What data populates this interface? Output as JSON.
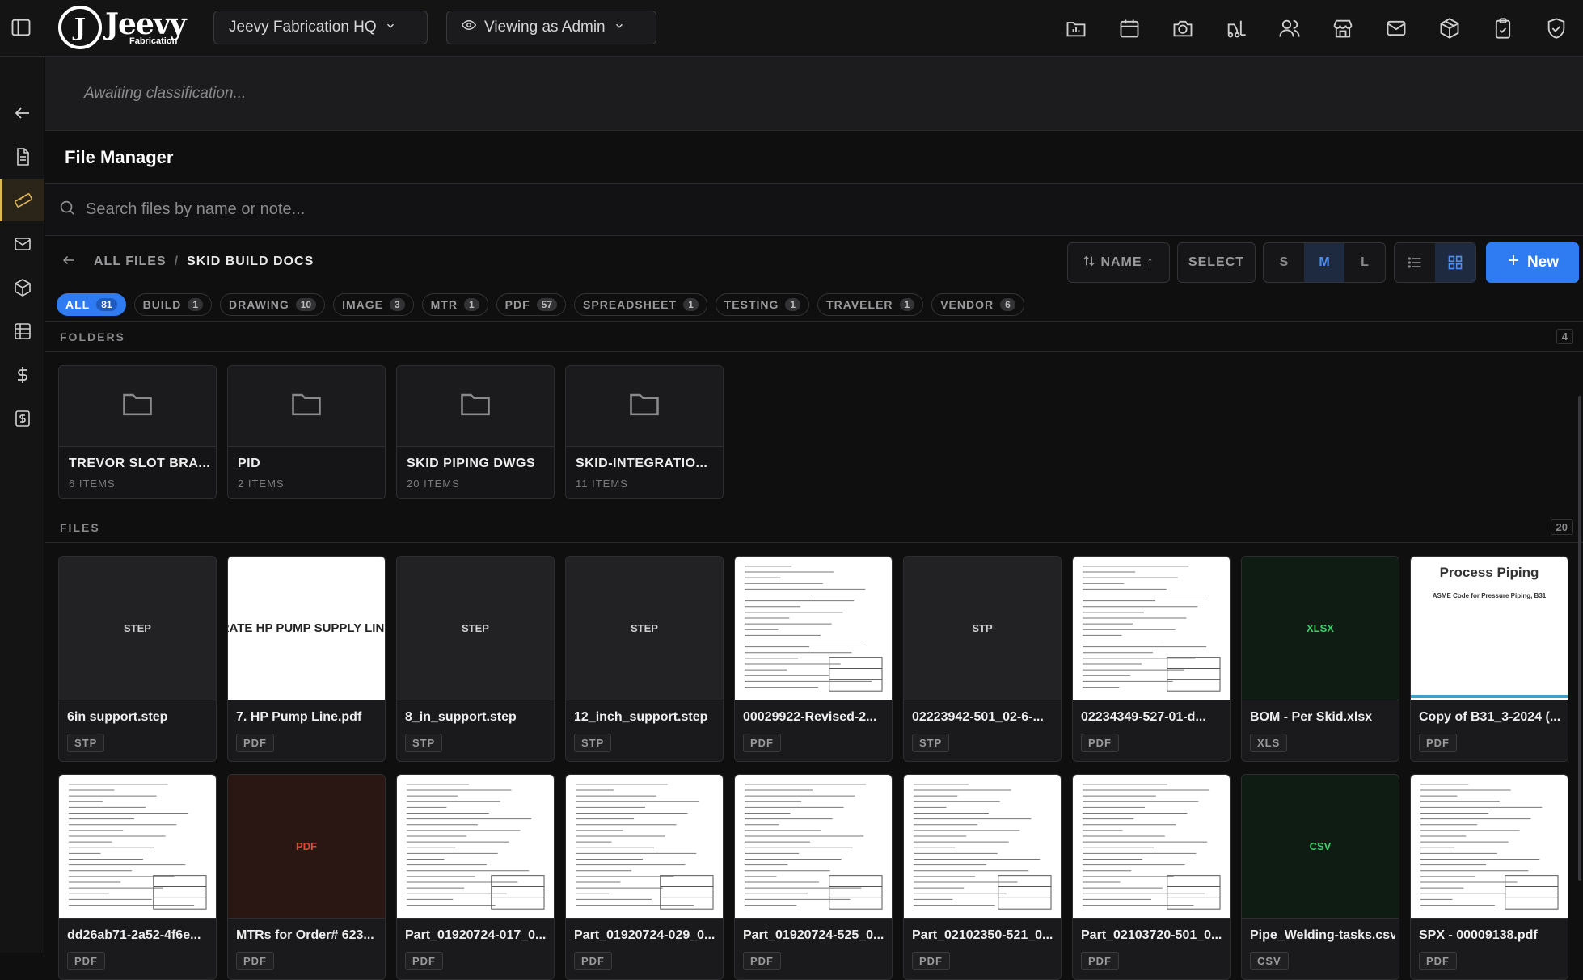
{
  "brand": {
    "name": "Jeevy",
    "sub": "Fabrication"
  },
  "header": {
    "org_selector": "Jeevy Fabrication HQ",
    "view_selector": "Viewing as Admin",
    "icons": [
      "chart-folder-icon",
      "calendar-icon",
      "camera-icon",
      "forklift-icon",
      "users-icon",
      "store-icon",
      "mail-icon",
      "package-icon",
      "clipboard-check-icon",
      "shield-check-icon"
    ]
  },
  "leftnav": {
    "icons": [
      "back-arrow-icon",
      "document-icon",
      "ruler-icon",
      "mail-icon",
      "box-icon",
      "table-icon",
      "dollar-icon",
      "receipt-icon"
    ],
    "active": "ruler-icon"
  },
  "classification": {
    "text": "Awaiting classification..."
  },
  "file_manager": {
    "title": "File Manager",
    "search_placeholder": "Search files by name or note...",
    "breadcrumb": {
      "root": "ALL FILES",
      "sep": "/",
      "current": "SKID BUILD DOCS"
    },
    "sort_label": "NAME",
    "select_label": "SELECT",
    "sizes": [
      "S",
      "M",
      "L"
    ],
    "active_size": "M",
    "new_label": "New",
    "filters": [
      {
        "label": "ALL",
        "count": "81"
      },
      {
        "label": "BUILD",
        "count": "1"
      },
      {
        "label": "DRAWING",
        "count": "10"
      },
      {
        "label": "IMAGE",
        "count": "3"
      },
      {
        "label": "MTR",
        "count": "1"
      },
      {
        "label": "PDF",
        "count": "57"
      },
      {
        "label": "SPREADSHEET",
        "count": "1"
      },
      {
        "label": "TESTING",
        "count": "1"
      },
      {
        "label": "TRAVELER",
        "count": "1"
      },
      {
        "label": "VENDOR",
        "count": "6"
      }
    ],
    "folders_label": "FOLDERS",
    "folders_count": "4",
    "folders": [
      {
        "name": "TREVOR SLOT BRA...",
        "items": "6 ITEMS"
      },
      {
        "name": "PID",
        "items": "2 ITEMS"
      },
      {
        "name": "SKID PIPING DWGS",
        "items": "20 ITEMS"
      },
      {
        "name": "SKID-INTEGRATIO...",
        "items": "11 ITEMS"
      }
    ],
    "files_label": "FILES",
    "files_count": "20",
    "files": [
      {
        "name": "6in support.step",
        "type": "STP",
        "thumb": "STEP",
        "style": "dark"
      },
      {
        "name": "7. HP Pump Line.pdf",
        "type": "PDF",
        "thumb": "RATE HP PUMP SUPPLY LINE",
        "style": "doc"
      },
      {
        "name": "8_in_support.step",
        "type": "STP",
        "thumb": "STEP",
        "style": "dark"
      },
      {
        "name": "12_inch_support.step",
        "type": "STP",
        "thumb": "STEP",
        "style": "dark"
      },
      {
        "name": "00029922-Revised-2...",
        "type": "PDF",
        "thumb": "",
        "style": "doc"
      },
      {
        "name": "02223942-501_02-6-...",
        "type": "STP",
        "thumb": "STP",
        "style": "dark"
      },
      {
        "name": "02234349-527-01-d...",
        "type": "PDF",
        "thumb": "",
        "style": "doc"
      },
      {
        "name": "BOM - Per Skid.xlsx",
        "type": "XLS",
        "thumb": "XLSX",
        "style": "green"
      },
      {
        "name": "Copy of B31_3-2024 (...",
        "type": "PDF",
        "thumb": "Process Piping",
        "thumb_sub": "ASME Code for Pressure Piping, B31",
        "style": "doc"
      },
      {
        "name": "dd26ab71-2a52-4f6e...",
        "type": "PDF",
        "thumb": "",
        "style": "doc"
      },
      {
        "name": "MTRs for Order# 623...",
        "type": "PDF",
        "thumb": "PDF",
        "style": "red"
      },
      {
        "name": "Part_01920724-017_0...",
        "type": "PDF",
        "thumb": "",
        "style": "doc"
      },
      {
        "name": "Part_01920724-029_0...",
        "type": "PDF",
        "thumb": "",
        "style": "doc"
      },
      {
        "name": "Part_01920724-525_0...",
        "type": "PDF",
        "thumb": "",
        "style": "doc"
      },
      {
        "name": "Part_02102350-521_0...",
        "type": "PDF",
        "thumb": "",
        "style": "doc"
      },
      {
        "name": "Part_02103720-501_0...",
        "type": "PDF",
        "thumb": "",
        "style": "doc"
      },
      {
        "name": "Pipe_Welding-tasks.csv",
        "type": "CSV",
        "thumb": "CSV",
        "style": "green"
      },
      {
        "name": "SPX - 00009138.pdf",
        "type": "PDF",
        "thumb": "",
        "style": "doc"
      }
    ]
  }
}
